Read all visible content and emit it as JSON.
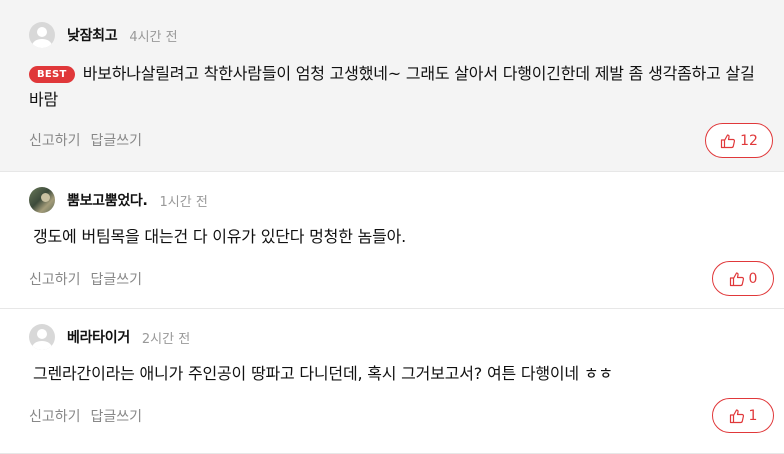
{
  "comments": [
    {
      "user": "낮잠최고",
      "time": "4시간 전",
      "best": true,
      "badge": "BEST",
      "text": "바보하나살릴려고 착한사람들이 엄청 고생했네~ 그래도 살아서 다행이긴한데 제발 좀 생각좀하고 살길바람",
      "likes": "12",
      "avatar": "default"
    },
    {
      "user": "뿜보고뿜었다.",
      "time": "1시간 전",
      "best": false,
      "text": "갱도에 버팀목을 대는건 다 이유가 있단다 멍청한 놈들아.",
      "likes": "0",
      "avatar": "photo"
    },
    {
      "user": "베라타이거",
      "time": "2시간 전",
      "best": false,
      "text": "그렌라간이라는 애니가 주인공이 땅파고 다니던데, 혹시 그거보고서? 여튼 다행이네 ㅎㅎ",
      "likes": "1",
      "avatar": "default"
    }
  ],
  "actions": {
    "report": "신고하기",
    "reply": "답글쓰기"
  },
  "icons": {
    "like": "thumbs-up-icon"
  },
  "colors": {
    "accent": "#e0383a",
    "best_bg": "#f4f4f4"
  }
}
